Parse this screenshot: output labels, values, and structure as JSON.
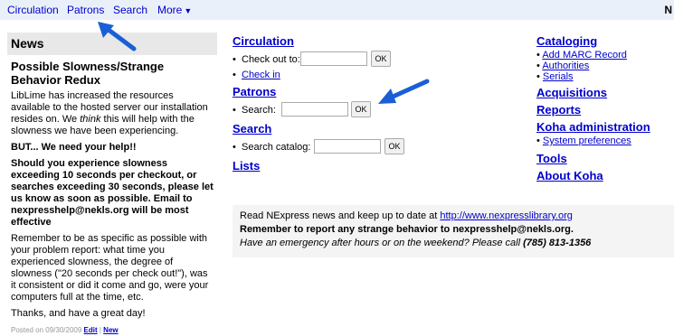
{
  "topnav": {
    "circulation": "Circulation",
    "patrons": "Patrons",
    "search": "Search",
    "more": "More",
    "user_fragment": "N"
  },
  "news": {
    "header": "News",
    "title": "Possible Slowness/Strange Behavior Redux",
    "p1_a": "LibLime has increased the resources available to the hosted server our installation resides on. We ",
    "p1_em": "think",
    "p1_b": " this will help with the slowness we have been experiencing.",
    "p2": "BUT... We need your help!!",
    "p3": "Should you experience slowness exceeding 10 seconds per checkout, or searches exceeding 30 seconds, please let us know as soon as possible. Email to nexpresshelp@nekls.org will be most effective",
    "p4": "Remember to be as specific as possible with your problem report: what time you experienced slowness, the degree of slowness (\"20 seconds per check out!\"), was it consistent or did it come and go, were your computers full at the time, etc.",
    "p5": "Thanks, and have a great day!",
    "posted": "Posted on 09/30/2009",
    "edit": "Edit",
    "sep": " | ",
    "new": "New"
  },
  "center": {
    "circulation_heading": "Circulation",
    "checkout_label": "Check out to:",
    "checkin_link": "Check in",
    "patrons_heading": "Patrons",
    "patron_search_label": "Search:",
    "search_heading": "Search",
    "catalog_search_label": "Search catalog:",
    "lists_heading": "Lists",
    "ok_label": "OK",
    "checkout_value": "",
    "patron_value": "",
    "catalog_value": ""
  },
  "right": {
    "cataloging": "Cataloging",
    "cataloging_items": [
      "Add MARC Record",
      "Authorities",
      "Serials"
    ],
    "acquisitions": "Acquisitions",
    "reports": "Reports",
    "koha_admin": "Koha administration",
    "admin_items": [
      "System preferences"
    ],
    "tools": "Tools",
    "about": "About Koha"
  },
  "announce": {
    "line1_text": "Read NExpress news and keep up to date at ",
    "line1_link": "http://www.nexpresslibrary.org",
    "line2": "Remember to report any strange behavior to nexpresshelp@nekls.org.",
    "line3_text": "Have an emergency after hours or on the weekend? Please call ",
    "line3_phone": "(785) 813-1356"
  },
  "colors": {
    "link": "#0000cc",
    "arrow": "#1a5fd6",
    "nav_bg": "#eaf0fa"
  }
}
